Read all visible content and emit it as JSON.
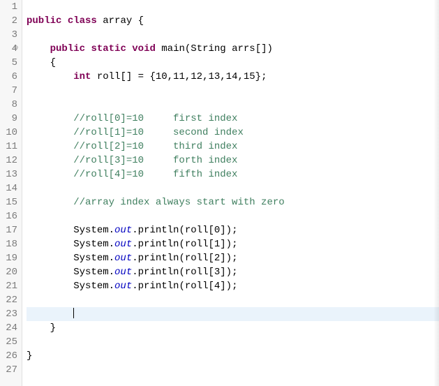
{
  "gutter": {
    "start": 1,
    "end": 27,
    "markerLine": 4,
    "markerGlyph": "⊖"
  },
  "currentLine": 23,
  "code": {
    "l2": {
      "pre": "",
      "k1": "public",
      "sp1": " ",
      "k2": "class",
      "sp2": " ",
      "name": "array",
      "sp3": " ",
      "brace": "{"
    },
    "l4": {
      "indent": "    ",
      "k1": "public",
      "sp1": " ",
      "k2": "static",
      "sp2": " ",
      "k3": "void",
      "sp3": " ",
      "rest": "main(String arrs[])"
    },
    "l5": "    {",
    "l6": {
      "indent": "        ",
      "kw": "int",
      "rest": " roll[] = {10,11,12,13,14,15};"
    },
    "l9": "        //roll[0]=10     first index",
    "l10": "        //roll[1]=10     second index",
    "l11": "        //roll[2]=10     third index",
    "l12": "        //roll[3]=10     forth index",
    "l13": "        //roll[4]=10     fifth index",
    "l15": "        //array index always start with zero",
    "l17": {
      "indent": "        ",
      "a": "System.",
      "b": "out",
      "c": ".println(roll[0]);"
    },
    "l18": {
      "indent": "        ",
      "a": "System.",
      "b": "out",
      "c": ".println(roll[1]);"
    },
    "l19": {
      "indent": "        ",
      "a": "System.",
      "b": "out",
      "c": ".println(roll[2]);"
    },
    "l20": {
      "indent": "        ",
      "a": "System.",
      "b": "out",
      "c": ".println(roll[3]);"
    },
    "l21": {
      "indent": "        ",
      "a": "System.",
      "b": "out",
      "c": ".println(roll[4]);"
    },
    "l24": "    }",
    "l26": "}"
  }
}
